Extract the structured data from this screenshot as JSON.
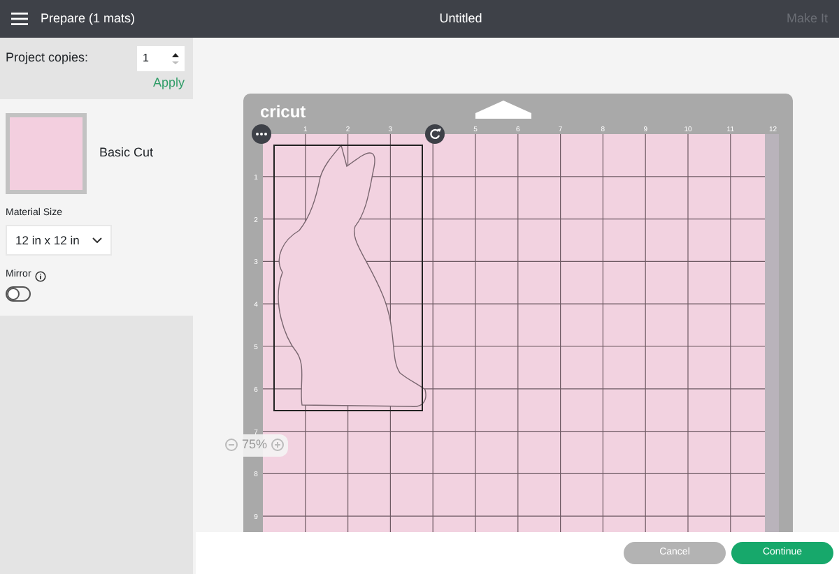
{
  "header": {
    "title": "Prepare (1 mats)",
    "document_title": "Untitled",
    "action": {
      "label": "Make It",
      "disabled": true
    }
  },
  "sidebar": {
    "copies": {
      "label": "Project copies:",
      "value": "1",
      "apply": "Apply"
    },
    "mats": [
      {
        "label": "Basic Cut",
        "selected": true
      }
    ],
    "material_size": {
      "label": "Material Size",
      "value": "12 in x 12 in"
    },
    "mirror": {
      "label": "Mirror",
      "on": false
    }
  },
  "mat": {
    "brand": "cricut",
    "top_ruler": [
      "1",
      "2",
      "3",
      "5",
      "6",
      "7",
      "8",
      "9",
      "10",
      "11",
      "12"
    ],
    "left_ruler": [
      "1",
      "2",
      "3",
      "4",
      "5",
      "6",
      "7",
      "8",
      "9"
    ]
  },
  "zoom": {
    "value": "75%"
  },
  "buttons": [
    {
      "label": "Cancel",
      "kind": "secondary"
    },
    {
      "label": "Continue",
      "kind": "primary"
    }
  ]
}
